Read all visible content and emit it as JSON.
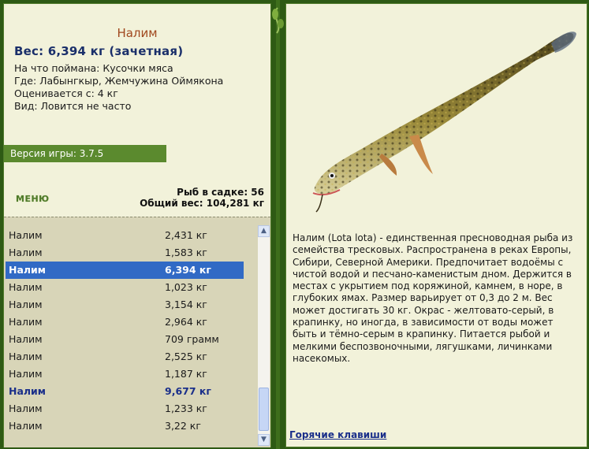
{
  "fish": {
    "name": "Налим",
    "weight_line": "Вес: 6,394 кг (зачетная)",
    "bait": "На что поймана: Кусочки мяса",
    "place": "Где: Лабынгкыр, Жемчужина Оймякона",
    "price": "Оценивается с: 4 кг",
    "kind": "Вид: Ловится не часто"
  },
  "version": "Версия игры: 3.7.5",
  "menu_label": "МЕНЮ",
  "stats": {
    "count": "Рыб в садке: 56",
    "total": "Общий вес: 104,281 кг"
  },
  "catch_list": [
    {
      "name": "Налим",
      "weight": "2,431 кг"
    },
    {
      "name": "Налим",
      "weight": "1,583 кг"
    },
    {
      "name": "Налим",
      "weight": "6,394 кг"
    },
    {
      "name": "Налим",
      "weight": "1,023 кг"
    },
    {
      "name": "Налим",
      "weight": "3,154 кг"
    },
    {
      "name": "Налим",
      "weight": "2,964 кг"
    },
    {
      "name": "Налим",
      "weight": "709 грамм"
    },
    {
      "name": "Налим",
      "weight": "2,525 кг"
    },
    {
      "name": "Налим",
      "weight": "1,187 кг"
    },
    {
      "name": "Налим",
      "weight": "9,677 кг"
    },
    {
      "name": "Налим",
      "weight": "1,233 кг"
    },
    {
      "name": "Налим",
      "weight": "3,22 кг"
    }
  ],
  "selected_index": 2,
  "highlighted_index": 9,
  "description": "Налим (Lota lota) - единственная пресноводная рыба из семейства тресковых. Распространена в реках Европы, Сибири, Северной Америки. Предпочитает водоёмы с чистой водой и песчано-каменистым дном. Держится в местах с укрытием под коряжиной, камнем, в норе, в глубоких ямах. Размер варьирует от 0,3 до 2 м. Вес может достигать 30 кг. Окрас - желтовато-серый, в крапинку, но иногда, в зависимости от воды может быть и тёмно-серым в крапинку. Питается рыбой и мелкими беспозвоночными, лягушками, личинками насекомых.",
  "hotkeys_label": "Горячие клавиши",
  "icons": {
    "scroll_up": "arrow-up-icon",
    "scroll_down": "arrow-down-icon"
  },
  "colors": {
    "selection": "#316ac5",
    "version_bar": "#5b8a2e",
    "panel": "#f2f2da",
    "list_bg": "#d8d5b8"
  }
}
